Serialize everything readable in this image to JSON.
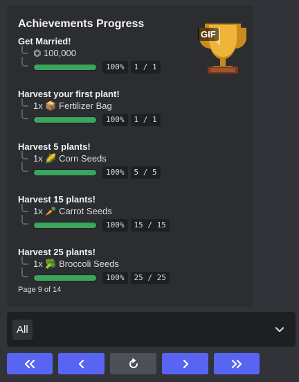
{
  "embed": {
    "title": "Achievements Progress",
    "thumbnail_badge": "GIF",
    "achievements": [
      {
        "name": "Get Married!",
        "reward": "⏣ 100,000",
        "reward_icon": "coin-icon",
        "progress": 1.0,
        "percent": "100%",
        "count": "1 / 1"
      },
      {
        "name": "Harvest your first plant!",
        "reward": "1x 📦 Fertilizer Bag",
        "reward_icon": "fertilizer-bag-icon",
        "progress": 1.0,
        "percent": "100%",
        "count": "1 / 1"
      },
      {
        "name": "Harvest 5 plants!",
        "reward": "1x 🌽 Corn Seeds",
        "reward_icon": "corn-seeds-icon",
        "progress": 1.0,
        "percent": "100%",
        "count": "5 / 5"
      },
      {
        "name": "Harvest 15 plants!",
        "reward": "1x 🥕 Carrot Seeds",
        "reward_icon": "carrot-seeds-icon",
        "progress": 1.0,
        "percent": "100%",
        "count": "15 / 15"
      },
      {
        "name": "Harvest 25 plants!",
        "reward": "1x 🥦 Broccoli Seeds",
        "reward_icon": "broccoli-seeds-icon",
        "progress": 1.0,
        "percent": "100%",
        "count": "25 / 25"
      }
    ],
    "footer": "Page 9 of 14"
  },
  "select": {
    "value": "All"
  },
  "colors": {
    "accent": "#5865f2",
    "progress": "#3ba55d",
    "embed_bg": "#2b2d31",
    "page_bg": "#313338"
  }
}
